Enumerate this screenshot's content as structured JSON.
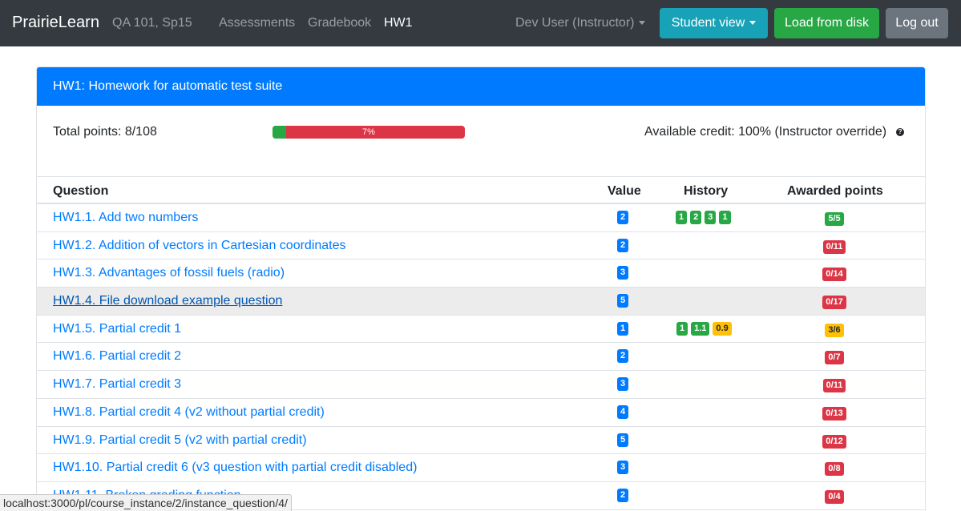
{
  "navbar": {
    "brand": "PrairieLearn",
    "course": "QA 101, Sp15",
    "links": [
      "Assessments",
      "Gradebook",
      "HW1"
    ],
    "user": "Dev User (Instructor)",
    "student_view": "Student view",
    "load_from_disk": "Load from disk",
    "log_out": "Log out"
  },
  "card": {
    "title": "HW1: Homework for automatic test suite",
    "total_points": "Total points: 8/108",
    "progress_percent": 7,
    "progress_label": "7%",
    "available_credit": "Available credit: 100% (Instructor override)",
    "help_glyph": "?"
  },
  "table": {
    "headers": [
      "Question",
      "Value",
      "History",
      "Awarded points"
    ],
    "rows": [
      {
        "title": "HW1.1. Add two numbers",
        "value": "2",
        "history": [
          {
            "v": "1",
            "c": "green"
          },
          {
            "v": "2",
            "c": "green"
          },
          {
            "v": "3",
            "c": "green"
          },
          {
            "v": "1",
            "c": "green"
          }
        ],
        "awarded": "5/5",
        "awarded_color": "green"
      },
      {
        "title": "HW1.2. Addition of vectors in Cartesian coordinates",
        "value": "2",
        "history": [],
        "awarded": "0/11",
        "awarded_color": "red"
      },
      {
        "title": "HW1.3. Advantages of fossil fuels (radio)",
        "value": "3",
        "history": [],
        "awarded": "0/14",
        "awarded_color": "red"
      },
      {
        "title": "HW1.4. File download example question",
        "value": "5",
        "history": [],
        "awarded": "0/17",
        "awarded_color": "red",
        "hover": true
      },
      {
        "title": "HW1.5. Partial credit 1",
        "value": "1",
        "history": [
          {
            "v": "1",
            "c": "green"
          },
          {
            "v": "1.1",
            "c": "green"
          },
          {
            "v": "0.9",
            "c": "yellow"
          }
        ],
        "awarded": "3/6",
        "awarded_color": "yellow"
      },
      {
        "title": "HW1.6. Partial credit 2",
        "value": "2",
        "history": [],
        "awarded": "0/7",
        "awarded_color": "red"
      },
      {
        "title": "HW1.7. Partial credit 3",
        "value": "3",
        "history": [],
        "awarded": "0/11",
        "awarded_color": "red"
      },
      {
        "title": "HW1.8. Partial credit 4 (v2 without partial credit)",
        "value": "4",
        "history": [],
        "awarded": "0/13",
        "awarded_color": "red"
      },
      {
        "title": "HW1.9. Partial credit 5 (v2 with partial credit)",
        "value": "5",
        "history": [],
        "awarded": "0/12",
        "awarded_color": "red"
      },
      {
        "title": "HW1.10. Partial credit 6 (v3 question with partial credit disabled)",
        "value": "3",
        "history": [],
        "awarded": "0/8",
        "awarded_color": "red"
      },
      {
        "title": "HW1.11. Broken grading function",
        "value": "2",
        "history": [],
        "awarded": "0/4",
        "awarded_color": "red"
      }
    ]
  },
  "statusbar": "localhost:3000/pl/course_instance/2/instance_question/4/",
  "colors": {
    "navbar": "#343a40",
    "primary": "#007bff",
    "success": "#28a745",
    "danger": "#dc3545",
    "warning": "#ffc107",
    "info": "#17a2b8",
    "secondary": "#6c757d"
  }
}
